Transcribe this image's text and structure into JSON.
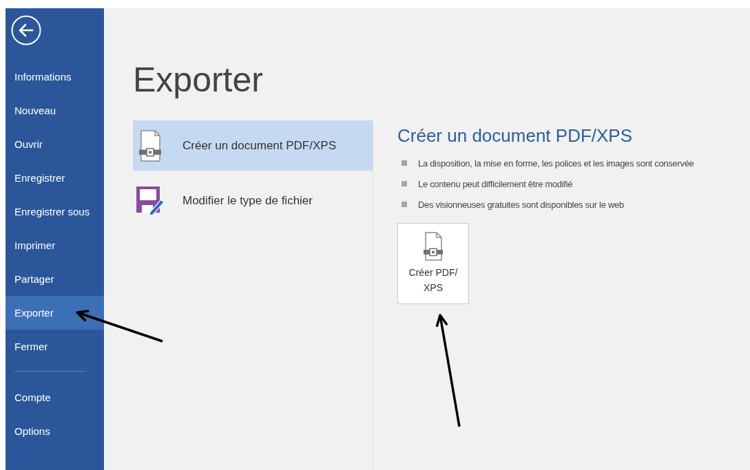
{
  "sidebar": {
    "back_button": {
      "kind": "back"
    },
    "items": [
      {
        "label": "Informations",
        "selected": false,
        "pointed_at": false
      },
      {
        "label": "Nouveau",
        "selected": false,
        "pointed_at": false
      },
      {
        "label": "Ouvrir",
        "selected": false,
        "pointed_at": false
      },
      {
        "label": "Enregistrer",
        "selected": false,
        "pointed_at": false
      },
      {
        "label": "Enregistrer sous",
        "selected": false,
        "pointed_at": false
      },
      {
        "label": "Imprimer",
        "selected": false,
        "pointed_at": false
      },
      {
        "label": "Partager",
        "selected": false,
        "pointed_at": false
      },
      {
        "label": "Exporter",
        "selected": true,
        "pointed_at": true
      },
      {
        "label": "Fermer",
        "selected": false,
        "pointed_at": false
      }
    ],
    "footer_items": [
      {
        "label": "Compte",
        "selected": false
      },
      {
        "label": "Options",
        "selected": false
      }
    ]
  },
  "page_title": "Exporter",
  "export_options": [
    {
      "label": "Créer un document PDF/XPS",
      "kind": "pdf",
      "selected": true
    },
    {
      "label": "Modifier le type de fichier",
      "kind": "save",
      "selected": false
    }
  ],
  "detail": {
    "title": "Créer un document PDF/XPS",
    "bullets": [
      "La disposition, la mise en forme, les polices et les images sont conservée",
      "Le contenu peut difficilement être modifié",
      "Des visionneuses gratuites sont disponibles sur le web"
    ],
    "action_button": {
      "label": "Créer PDF/ XPS",
      "pointed_at": true
    }
  }
}
